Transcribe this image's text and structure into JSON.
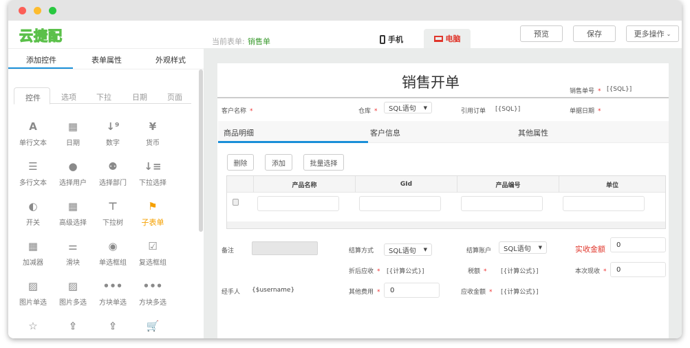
{
  "logo": "云捷配",
  "header": {
    "current_label": "当前表单:",
    "current_form": "销售单",
    "tab_mobile": "手机",
    "tab_pc": "电脑",
    "preview": "预览",
    "save": "保存",
    "more": "更多操作"
  },
  "left": {
    "tabs": [
      "添加控件",
      "表单属性",
      "外观样式"
    ],
    "subtabs": [
      "控件",
      "选项",
      "下拉",
      "日期",
      "页面"
    ],
    "controls": [
      {
        "label": "单行文本",
        "icon": "A"
      },
      {
        "label": "日期",
        "icon": "▦"
      },
      {
        "label": "数字",
        "icon": "↓⁹"
      },
      {
        "label": "货币",
        "icon": "¥"
      },
      {
        "label": "多行文本",
        "icon": "☰"
      },
      {
        "label": "选择用户",
        "icon": "●"
      },
      {
        "label": "选择部门",
        "icon": "⚉"
      },
      {
        "label": "下拉选择",
        "icon": "↓≡"
      },
      {
        "label": "开关",
        "icon": "◐"
      },
      {
        "label": "高级选择",
        "icon": "▦"
      },
      {
        "label": "下拉树",
        "icon": "⊤"
      },
      {
        "label": "子表单",
        "icon": "⚑"
      },
      {
        "label": "加减器",
        "icon": "▦"
      },
      {
        "label": "滑块",
        "icon": "⚌"
      },
      {
        "label": "单选框组",
        "icon": "◉"
      },
      {
        "label": "复选框组",
        "icon": "☑"
      },
      {
        "label": "图片单选",
        "icon": "▨"
      },
      {
        "label": "图片多选",
        "icon": "▨"
      },
      {
        "label": "方块单选",
        "icon": "•••"
      },
      {
        "label": "方块多选",
        "icon": "•••"
      },
      {
        "label": "",
        "icon": "☆"
      },
      {
        "label": "",
        "icon": "⇪"
      },
      {
        "label": "",
        "icon": "⇪"
      },
      {
        "label": "",
        "icon": "🛒"
      }
    ]
  },
  "form": {
    "title": "销售开单",
    "order_no_label": "销售单号",
    "order_no_value": "[{SQL}]",
    "customer_label": "客户名称",
    "warehouse_label": "仓库",
    "warehouse_value": "SQL语句",
    "ref_label": "引用订单",
    "ref_value": "[{SQL}]",
    "date_label": "单据日期",
    "tabs": [
      "商品明细",
      "客户信息",
      "其他属性"
    ],
    "buttons": [
      "删除",
      "添加",
      "批量选择"
    ],
    "columns": [
      "产品名称",
      "GId",
      "产品编号",
      "单位"
    ],
    "remark_label": "备注",
    "settle_label": "结算方式",
    "settle_value": "SQL语句",
    "account_label": "结算账户",
    "account_value": "SQL语句",
    "received_label": "实收金额",
    "received_value": "0",
    "discount_label": "折后应收",
    "discount_value": "[{计算公式}]",
    "tax_label": "税额",
    "tax_value": "[{计算公式}]",
    "cash_label": "本次现收",
    "cash_value": "0",
    "handler_label": "经手人",
    "handler_value": "{$username}",
    "other_label": "其他费用",
    "other_value": "0",
    "due_label": "应收金额",
    "due_value": "[{计算公式}]"
  },
  "colors": {
    "accent": "#1a8fd8",
    "green": "#3a9a2e",
    "red": "#e0362b",
    "orange": "#f5a000"
  }
}
